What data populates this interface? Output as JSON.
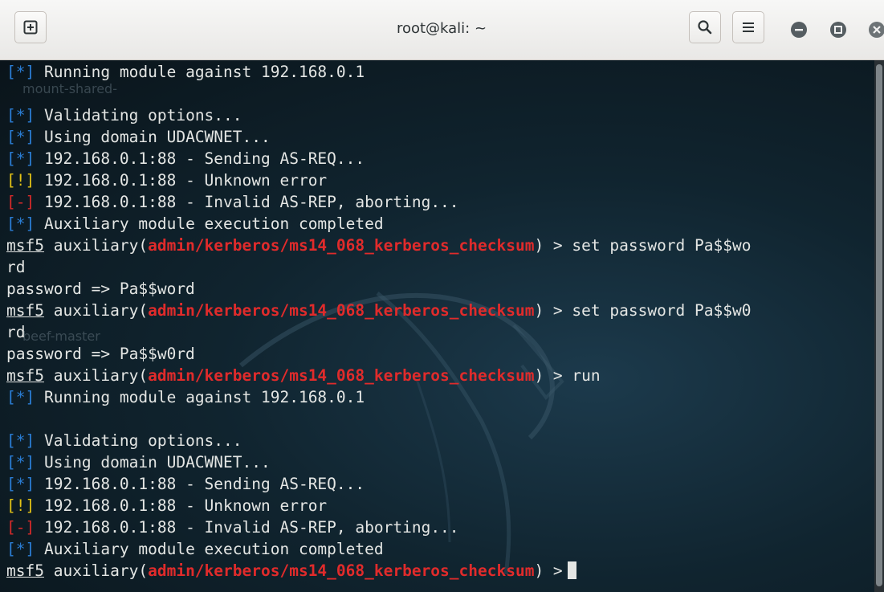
{
  "window": {
    "title": "root@kali: ~",
    "accent": "#2b7ed6"
  },
  "toolbar": {
    "new_tab_icon": "new-tab-icon",
    "search_icon": "search-icon",
    "menu_icon": "hamburger-menu-icon"
  },
  "desktop_labels": [
    "mount-shared-",
    "beef-master"
  ],
  "terminal": {
    "lines": [
      {
        "p": "[*]",
        "pt": "bi",
        "t": " Running module against 192.168.0.1"
      },
      {
        "p": "",
        "pt": "",
        "t": ""
      },
      {
        "p": "[*]",
        "pt": "bi",
        "t": " Validating options..."
      },
      {
        "p": "[*]",
        "pt": "bi",
        "t": " Using domain UDACWNET..."
      },
      {
        "p": "[*]",
        "pt": "bi",
        "t": " 192.168.0.1:88 - Sending AS-REQ..."
      },
      {
        "p": "[!]",
        "pt": "bw",
        "t": " 192.168.0.1:88 - Unknown error"
      },
      {
        "p": "[-]",
        "pt": "be",
        "t": " 192.168.0.1:88 - Invalid AS-REP, aborting..."
      },
      {
        "p": "[*]",
        "pt": "bi",
        "t": " Auxiliary module execution completed"
      },
      {
        "prompt": true,
        "msf": "msf5",
        "aux": " auxiliary(",
        "mod": "admin/kerberos/ms14_068_kerberos_checksum",
        "end": ") > set password Pa$$wo"
      },
      {
        "p": "",
        "pt": "",
        "t": "rd"
      },
      {
        "p": "",
        "pt": "",
        "t": "password => Pa$$word"
      },
      {
        "prompt": true,
        "msf": "msf5",
        "aux": " auxiliary(",
        "mod": "admin/kerberos/ms14_068_kerberos_checksum",
        "end": ") > set password Pa$$w0"
      },
      {
        "p": "",
        "pt": "",
        "t": "rd"
      },
      {
        "p": "",
        "pt": "",
        "t": "password => Pa$$w0rd"
      },
      {
        "prompt": true,
        "msf": "msf5",
        "aux": " auxiliary(",
        "mod": "admin/kerberos/ms14_068_kerberos_checksum",
        "end": ") > run"
      },
      {
        "p": "[*]",
        "pt": "bi",
        "t": " Running module against 192.168.0.1"
      },
      {
        "p": "",
        "pt": "",
        "t": ""
      },
      {
        "p": "[*]",
        "pt": "bi",
        "t": " Validating options..."
      },
      {
        "p": "[*]",
        "pt": "bi",
        "t": " Using domain UDACWNET..."
      },
      {
        "p": "[*]",
        "pt": "bi",
        "t": " 192.168.0.1:88 - Sending AS-REQ..."
      },
      {
        "p": "[!]",
        "pt": "bw",
        "t": " 192.168.0.1:88 - Unknown error"
      },
      {
        "p": "[-]",
        "pt": "be",
        "t": " 192.168.0.1:88 - Invalid AS-REP, aborting..."
      },
      {
        "p": "[*]",
        "pt": "bi",
        "t": " Auxiliary module execution completed"
      },
      {
        "prompt": true,
        "msf": "msf5",
        "aux": " auxiliary(",
        "mod": "admin/kerberos/ms14_068_kerberos_checksum",
        "end": ") >",
        "cursor": true
      }
    ]
  }
}
